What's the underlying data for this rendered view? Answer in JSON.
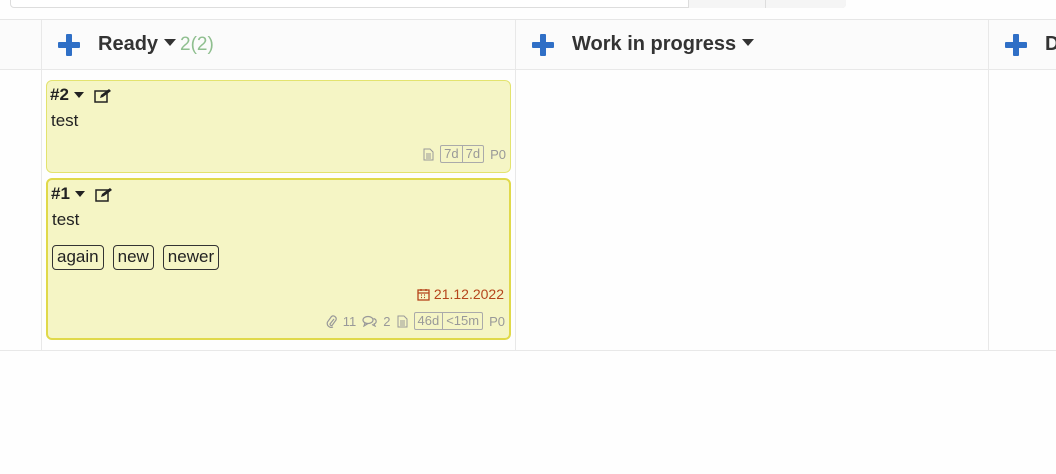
{
  "board": {
    "columns": [
      {
        "title": "Ready",
        "count": "2(2)",
        "cards": [
          {
            "id": "#2",
            "title": "test",
            "tags": [],
            "due": "",
            "attachments": "",
            "comments": "",
            "age": "7d",
            "time": "7d",
            "priority": "P0"
          },
          {
            "id": "#1",
            "title": "test",
            "tags": [
              "again",
              "new",
              "newer"
            ],
            "due": "21.12.2022",
            "attachments": "11",
            "comments": "2",
            "age": "46d",
            "time": "<15m",
            "priority": "P0"
          }
        ]
      },
      {
        "title": "Work in progress",
        "count": ""
      },
      {
        "title": "D",
        "count": ""
      }
    ]
  },
  "colors": {
    "accent": "#2f6fc6",
    "card_bg": "#f5f5c5",
    "card_border": "#e3e36e",
    "due": "#b5451b",
    "count": "#8fbf8f"
  },
  "icons": {
    "add": "plus-icon",
    "edit": "edit-icon",
    "menu": "caret-down-icon",
    "due": "calendar-icon",
    "attachment": "paperclip-icon",
    "comment": "comments-icon",
    "description": "document-icon"
  }
}
